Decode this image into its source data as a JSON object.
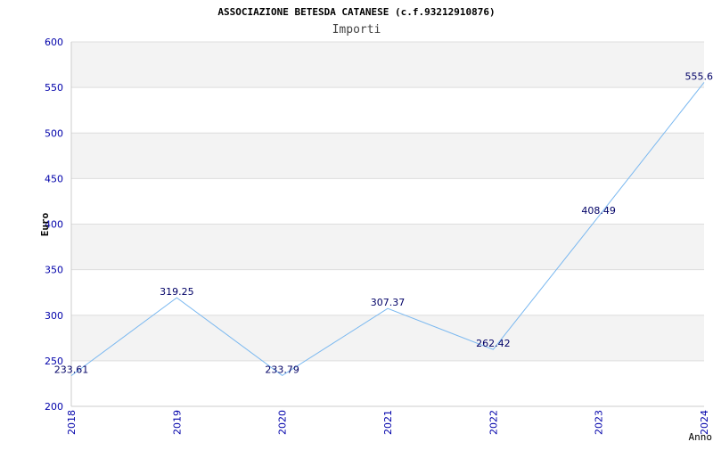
{
  "chart_data": {
    "type": "line",
    "title": "ASSOCIAZIONE BETESDA CATANESE (c.f.93212910876)",
    "subtitle": "Importi",
    "xlabel": "Anno",
    "ylabel": "Euro",
    "categories": [
      "2018",
      "2019",
      "2020",
      "2021",
      "2022",
      "2023",
      "2024"
    ],
    "series": [
      {
        "values": [
          233.61,
          319.25,
          233.79,
          307.37,
          262.42,
          408.49,
          555.6
        ]
      }
    ],
    "data_labels": [
      "233.61",
      "319.25",
      "233.79",
      "307.37",
      "262.42",
      "408.49",
      "555.6"
    ],
    "ylim": [
      200,
      600
    ],
    "yticks": [
      "200",
      "250",
      "300",
      "350",
      "400",
      "450",
      "500",
      "550",
      "600"
    ],
    "grid": true,
    "colors": {
      "line": "#7ab8f0",
      "band_light": "#f3f3f3",
      "band_white": "#ffffff",
      "gridline": "#dddddd",
      "tick_text": "#0000aa",
      "label_text": "#000066",
      "title_text": "#000000"
    }
  }
}
